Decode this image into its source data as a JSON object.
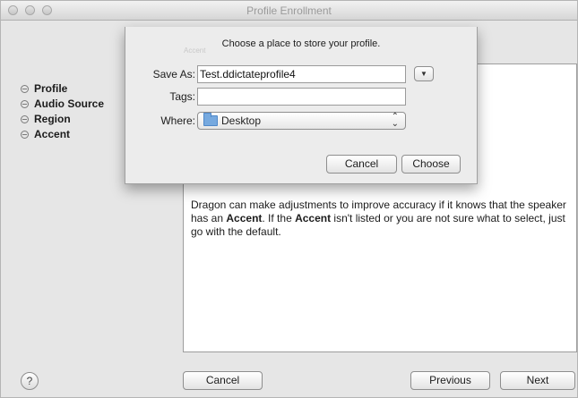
{
  "window": {
    "title": "Profile Enrollment"
  },
  "sidebar": {
    "steps": [
      {
        "label": "Profile"
      },
      {
        "label": "Audio Source"
      },
      {
        "label": "Region"
      },
      {
        "label": "Accent"
      }
    ]
  },
  "main": {
    "ghost_label": "Accent",
    "desc_1": "Dragon can make adjustments to improve accuracy if it knows that the speaker has an ",
    "desc_2": "Accent",
    "desc_3": ". If the ",
    "desc_4": "Accent",
    "desc_5": " isn't listed or you are not sure what to select, just go with the default."
  },
  "footer": {
    "help_label": "?",
    "cancel_label": "Cancel",
    "previous_label": "Previous",
    "next_label": "Next"
  },
  "sheet": {
    "title": "Choose a place to store your profile.",
    "save_as_label": "Save As:",
    "save_as_value": "Test.ddictateprofile4",
    "tags_label": "Tags:",
    "tags_value": "",
    "where_label": "Where:",
    "where_value": "Desktop",
    "cancel_label": "Cancel",
    "choose_label": "Choose",
    "expand_glyph": "▼",
    "popup_glyph": "⌃⌄"
  }
}
